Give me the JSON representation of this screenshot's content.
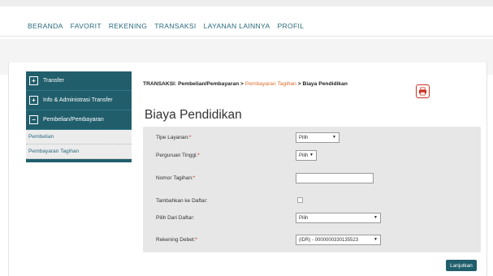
{
  "nav": {
    "items": [
      "BERANDA",
      "FAVORIT",
      "REKENING",
      "TRANSAKSI",
      "LAYANAN LAINNYA",
      "PROFIL"
    ]
  },
  "sidebar": {
    "items": [
      {
        "label": "Transfer",
        "marker": "+"
      },
      {
        "label": "Info & Administrasi Transfer",
        "marker": "+"
      },
      {
        "label": "Pembelian/Pembayaran",
        "marker": "−"
      }
    ],
    "subitems": [
      "Pembelian",
      "Pembayaran Tagihan"
    ]
  },
  "breadcrumb": {
    "prefix": "TRANSAKSI: Pembelian/Pembayaran > ",
    "current_section": "Pembayaran Tagihan",
    "suffix": " > Biaya Pendidikan"
  },
  "page": {
    "title": "Biaya Pendidikan"
  },
  "form": {
    "tipe_layanan": {
      "label": "Tipe Layanan:",
      "value": "Pilih"
    },
    "perguruan_tinggi": {
      "label": "Perguruan Tinggi:",
      "value": "Pilih"
    },
    "nomor_tagihan": {
      "label": "Nomor Tagihan:",
      "value": ""
    },
    "tambahkan_daftar": {
      "label": "Tambahkan ke Daftar:"
    },
    "pilih_daftar": {
      "label": "Pilih Dari Daftar:",
      "value": "Pilih"
    },
    "rekening_debet": {
      "label": "Rekening Debet:",
      "value": "(IDR) - 0000000330135523"
    },
    "required_marker": "*",
    "dropdown_arrow": "▼"
  },
  "actions": {
    "lanjutkan": "Lanjutkan"
  },
  "icons": {
    "print": "printer-icon"
  },
  "colors": {
    "brand": "#215e6c",
    "accent": "#e06a2a",
    "required": "#e03030",
    "print": "#cc3322"
  }
}
